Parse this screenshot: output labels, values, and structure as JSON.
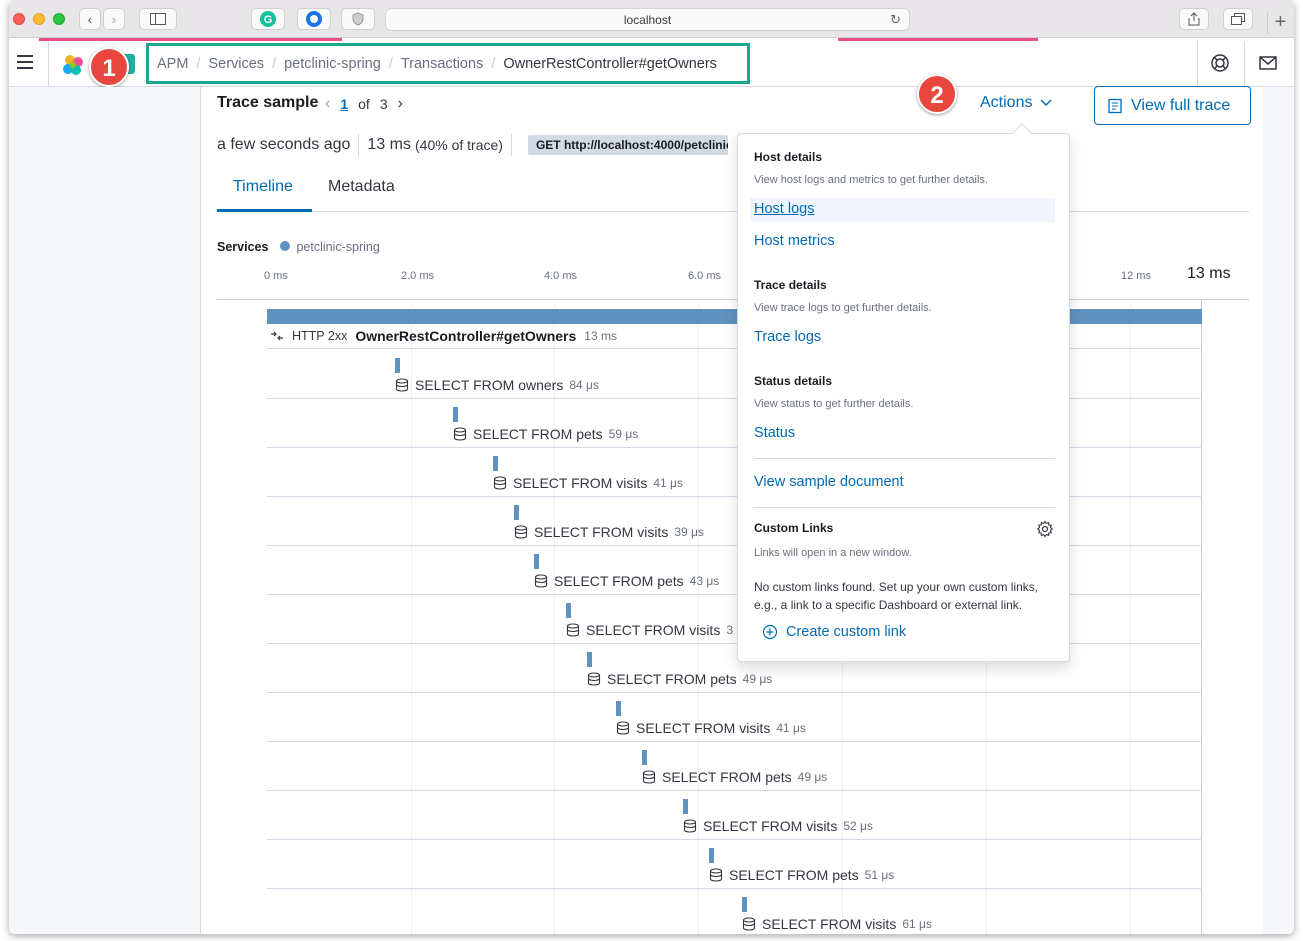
{
  "browser": {
    "url": "localhost"
  },
  "breadcrumbs": [
    {
      "label": "APM"
    },
    {
      "label": "Services"
    },
    {
      "label": "petclinic-spring"
    },
    {
      "label": "Transactions"
    },
    {
      "label": "OwnerRestController#getOwners"
    }
  ],
  "annotations": {
    "badge1": "1",
    "badge2": "2"
  },
  "trace": {
    "title": "Trace sample",
    "page_current": "1",
    "page_of": "of",
    "page_total": "3",
    "time_ago": "a few seconds ago",
    "duration": "13 ms",
    "duration_pct": "(40% of trace)",
    "request": "GET http://localhost:4000/petclinic/api/owners"
  },
  "header_actions": {
    "actions_label": "Actions",
    "view_full_trace_label": "View full trace"
  },
  "tabs": {
    "timeline": "Timeline",
    "metadata": "Metadata"
  },
  "services_legend": {
    "label": "Services",
    "service": "petclinic-spring",
    "service_color": "#6092c0"
  },
  "timeline_axis": {
    "ticks": [
      "0 ms",
      "2.0 ms",
      "4.0 ms",
      "6.0 ms",
      "12 ms"
    ],
    "end_label": "13 ms"
  },
  "root_transaction": {
    "status": "HTTP 2xx",
    "name": "OwnerRestController#getOwners",
    "duration": "13 ms"
  },
  "spans": [
    {
      "name": "SELECT FROM owners",
      "duration": "84 μs"
    },
    {
      "name": "SELECT FROM pets",
      "duration": "59 μs"
    },
    {
      "name": "SELECT FROM visits",
      "duration": "41 μs"
    },
    {
      "name": "SELECT FROM visits",
      "duration": "39 μs"
    },
    {
      "name": "SELECT FROM pets",
      "duration": "43 μs"
    },
    {
      "name": "SELECT FROM visits",
      "duration": "3"
    },
    {
      "name": "SELECT FROM pets",
      "duration": "49 μs"
    },
    {
      "name": "SELECT FROM visits",
      "duration": "41 μs"
    },
    {
      "name": "SELECT FROM pets",
      "duration": "49 μs"
    },
    {
      "name": "SELECT FROM visits",
      "duration": "52 μs"
    },
    {
      "name": "SELECT FROM pets",
      "duration": "51 μs"
    },
    {
      "name": "SELECT FROM visits",
      "duration": "61 μs"
    }
  ],
  "actions_menu": {
    "host_title": "Host details",
    "host_desc": "View host logs and metrics to get further details.",
    "host_logs": "Host logs",
    "host_metrics": "Host metrics",
    "trace_title": "Trace details",
    "trace_desc": "View trace logs to get further details.",
    "trace_logs": "Trace logs",
    "status_title": "Status details",
    "status_desc": "View status to get further details.",
    "status": "Status",
    "view_sample_document": "View sample document",
    "custom_links_title": "Custom Links",
    "custom_links_desc": "Links will open in a new window.",
    "custom_links_empty_1": "No custom links found. Set up your own custom links,",
    "custom_links_empty_2": "e.g., a link to a specific Dashboard or external link.",
    "create_custom_link": "Create custom link"
  },
  "colors": {
    "accent": "#006bb4",
    "highlight_border": "#1aa88e",
    "annotation_badge": "#e8473f",
    "span_bar": "#6092c0"
  }
}
